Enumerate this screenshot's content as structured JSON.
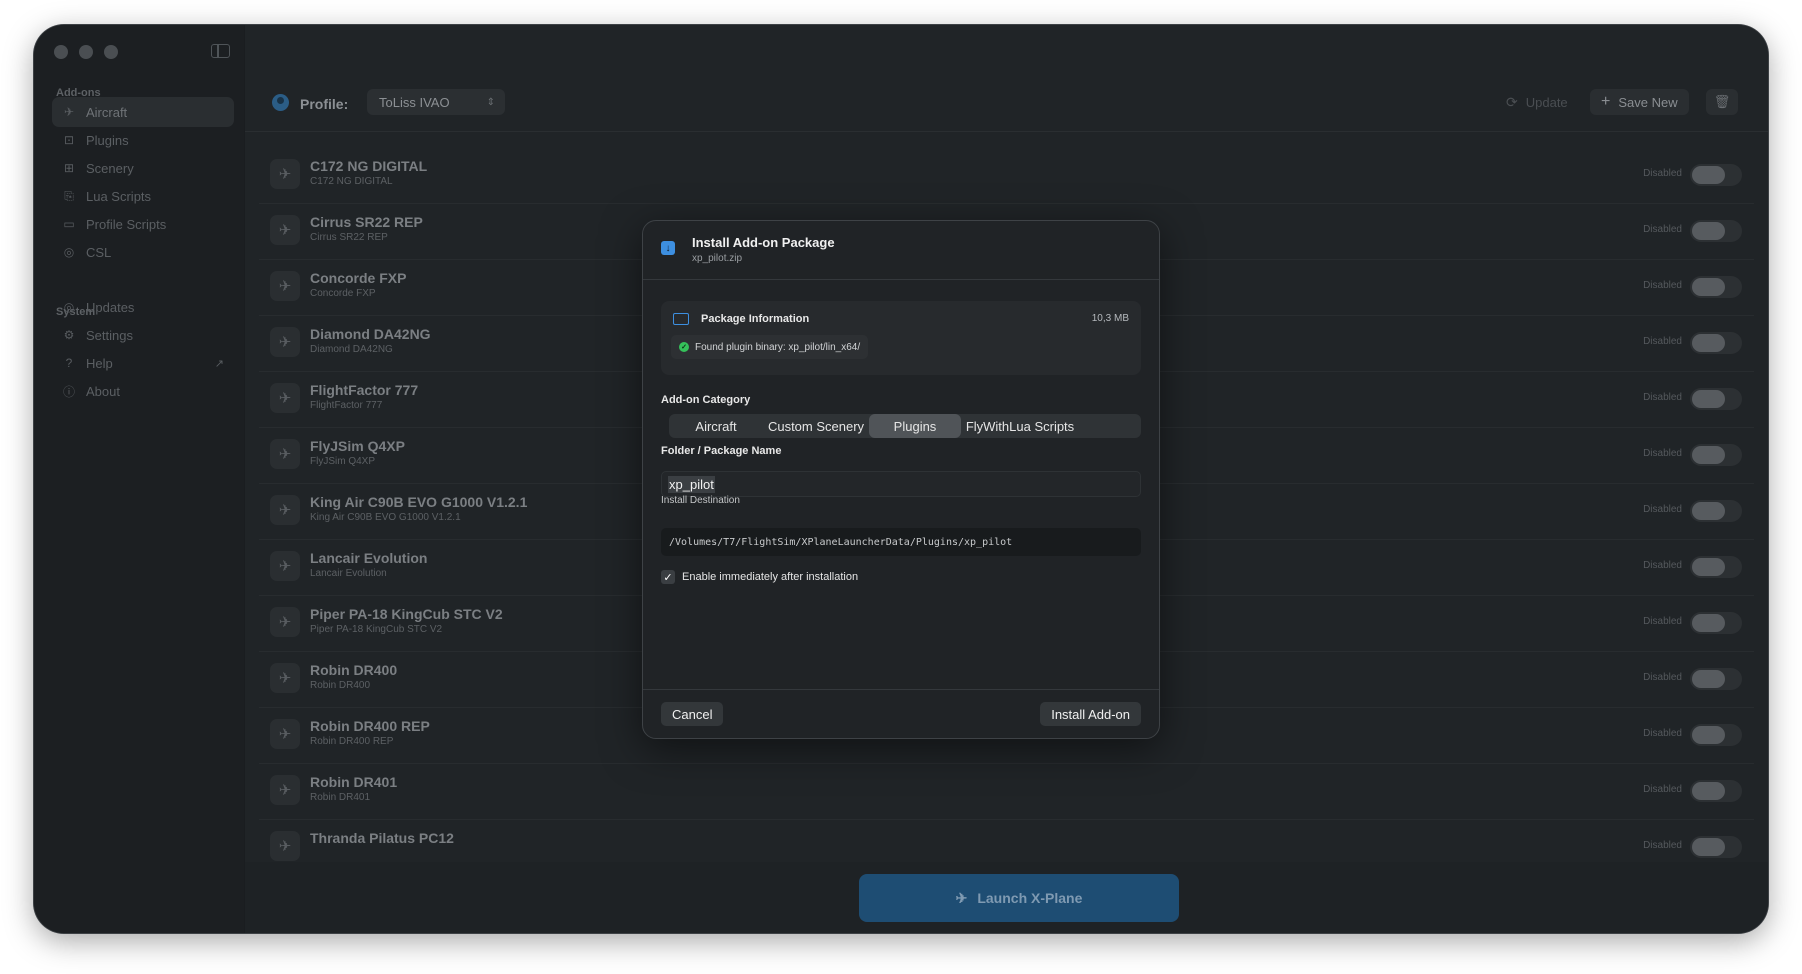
{
  "sidebar": {
    "addons_title": "Add-ons",
    "system_title": "System",
    "addons": [
      {
        "label": "Aircraft",
        "icon": "airplane-icon",
        "glyph": "✈"
      },
      {
        "label": "Plugins",
        "icon": "plugin-icon",
        "glyph": "⊡"
      },
      {
        "label": "Scenery",
        "icon": "map-icon",
        "glyph": "⊞"
      },
      {
        "label": "Lua Scripts",
        "icon": "script-icon",
        "glyph": "⎘"
      },
      {
        "label": "Profile Scripts",
        "icon": "terminal-icon",
        "glyph": "▭"
      },
      {
        "label": "CSL",
        "icon": "csl-icon",
        "glyph": "◎"
      }
    ],
    "system": [
      {
        "label": "Updates",
        "icon": "updates-icon",
        "glyph": "◎"
      },
      {
        "label": "Settings",
        "icon": "gear-icon",
        "glyph": "⚙"
      },
      {
        "label": "Help",
        "icon": "help-icon",
        "glyph": "?"
      },
      {
        "label": "About",
        "icon": "info-icon",
        "glyph": "ⓘ"
      }
    ],
    "help_external": "↗"
  },
  "toolbar": {
    "profile_label": "Profile:",
    "profile_value": "ToLiss IVAO",
    "update_label": "Update",
    "save_new_label": "Save New"
  },
  "aircraft": [
    {
      "name": "C172 NG DIGITAL",
      "sub": "C172 NG DIGITAL",
      "status": "Disabled"
    },
    {
      "name": "Cirrus SR22 REP",
      "sub": "Cirrus SR22 REP",
      "status": "Disabled"
    },
    {
      "name": "Concorde FXP",
      "sub": "Concorde FXP",
      "status": "Disabled"
    },
    {
      "name": "Diamond DA42NG",
      "sub": "Diamond DA42NG",
      "status": "Disabled"
    },
    {
      "name": "FlightFactor 777",
      "sub": "FlightFactor 777",
      "status": "Disabled"
    },
    {
      "name": "FlyJSim Q4XP",
      "sub": "FlyJSim Q4XP",
      "status": "Disabled"
    },
    {
      "name": "King Air C90B EVO G1000 V1.2.1",
      "sub": "King Air C90B EVO G1000 V1.2.1",
      "status": "Disabled"
    },
    {
      "name": "Lancair Evolution",
      "sub": "Lancair Evolution",
      "status": "Disabled"
    },
    {
      "name": "Piper PA-18  KingCub STC V2",
      "sub": "Piper PA-18  KingCub STC V2",
      "status": "Disabled"
    },
    {
      "name": "Robin DR400",
      "sub": "Robin DR400",
      "status": "Disabled"
    },
    {
      "name": "Robin DR400 REP",
      "sub": "Robin DR400 REP",
      "status": "Disabled"
    },
    {
      "name": "Robin DR401",
      "sub": "Robin DR401",
      "status": "Disabled"
    },
    {
      "name": "Thranda Pilatus PC12",
      "sub": "",
      "status": "Disabled"
    }
  ],
  "launch": {
    "label": "Launch X-Plane"
  },
  "modal": {
    "title": "Install Add-on Package",
    "filename": "xp_pilot.zip",
    "package_info_title": "Package Information",
    "package_size": "10,3 MB",
    "found_text": "Found plugin binary: xp_pilot/lin_x64/",
    "category_label": "Add-on Category",
    "categories": [
      "Aircraft",
      "Custom Scenery",
      "Plugins",
      "FlyWithLua Scripts"
    ],
    "selected_category": "Plugins",
    "name_label": "Folder / Package Name",
    "name_value": "xp_pilot",
    "dest_label": "Install Destination",
    "dest_value": "/Volumes/T7/FlightSim/XPlaneLauncherData/Plugins/xp_pilot",
    "enable_label": "Enable immediately after installation",
    "enable_checked": true,
    "cancel_label": "Cancel",
    "install_label": "Install Add-on"
  },
  "colors": {
    "accent": "#3d8fe0",
    "launch": "#1e4d73",
    "success": "#35c15a"
  }
}
